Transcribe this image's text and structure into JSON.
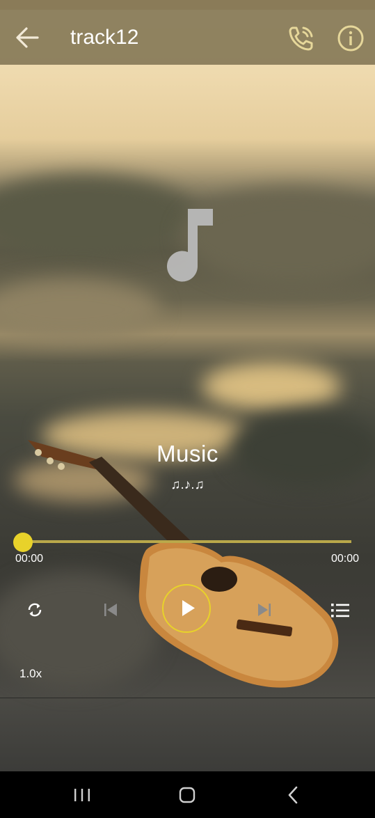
{
  "toolbar": {
    "title": "track12",
    "back_icon": "arrow-left-icon",
    "call_icon": "phone-call-icon",
    "info_icon": "info-icon"
  },
  "album_art": {
    "icon": "music-note-icon"
  },
  "track": {
    "title": "Music",
    "artist": "♫.♪.♫"
  },
  "progress": {
    "current_time": "00:00",
    "total_time": "00:00",
    "fraction": 0
  },
  "controls": {
    "repeat_icon": "repeat-icon",
    "previous_icon": "skip-previous-icon",
    "play_icon": "play-icon",
    "next_icon": "skip-next-icon",
    "playlist_icon": "playlist-icon",
    "speed": "1.0x"
  },
  "navbar": {
    "recents_icon": "recents-icon",
    "home_icon": "home-icon",
    "back_icon": "nav-back-icon"
  },
  "colors": {
    "accent": "#e8d22a",
    "toolbar": "#877a58",
    "seek_track": "#b9a84a",
    "icon_disabled": "#8a8a8a"
  }
}
